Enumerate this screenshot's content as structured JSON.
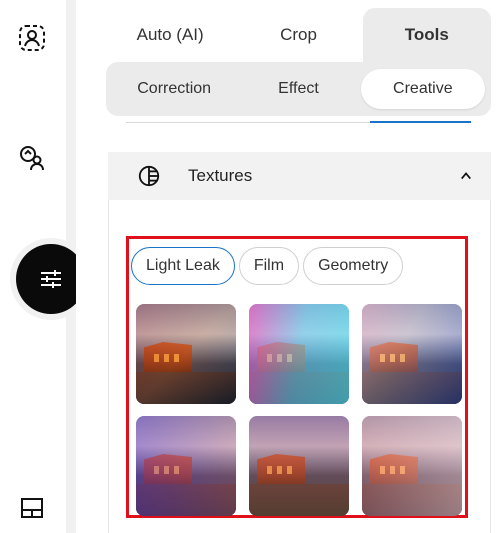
{
  "rail": {
    "icons": [
      "portrait-frame-icon",
      "face-swap-icon",
      "adjust-sliders-icon",
      "layout-icon"
    ]
  },
  "top_tabs": [
    {
      "label": "Auto (AI)",
      "active": false
    },
    {
      "label": "Crop",
      "active": false
    },
    {
      "label": "Tools",
      "active": true
    }
  ],
  "sub_tabs": [
    {
      "label": "Correction",
      "active": false
    },
    {
      "label": "Effect",
      "active": false
    },
    {
      "label": "Creative",
      "active": true
    }
  ],
  "section": {
    "title": "Textures",
    "icon": "texture-icon",
    "expanded": true
  },
  "chips": [
    {
      "label": "Light Leak",
      "active": true
    },
    {
      "label": "Film",
      "active": false
    },
    {
      "label": "Geometry",
      "active": false
    }
  ],
  "thumbnails": [
    "light-leak-1",
    "light-leak-2",
    "light-leak-3",
    "light-leak-4",
    "light-leak-5",
    "light-leak-6"
  ],
  "colors": {
    "accent": "#1a73c8",
    "highlight": "#e0101a",
    "active_rail": "#0a0a0a"
  }
}
